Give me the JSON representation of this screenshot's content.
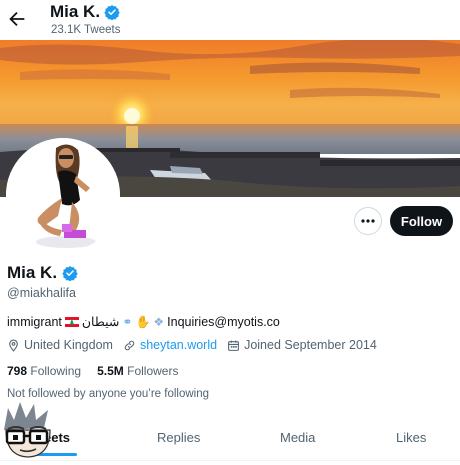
{
  "header": {
    "name": "Mia K.",
    "tweet_count": "23.1K Tweets"
  },
  "profile": {
    "name": "Mia K.",
    "handle": "@miakhalifa",
    "bio": {
      "prefix": "immigrant",
      "arabic": "شيطان",
      "inquiries": "Inquiries@myotis.co"
    },
    "location": "United Kingdom",
    "website": "sheytan.world",
    "joined": "Joined September 2014",
    "following_count": "798",
    "following_label": "Following",
    "followers_count": "5.5M",
    "followers_label": "Followers",
    "followed_by": "Not followed by anyone you’re following"
  },
  "actions": {
    "follow_label": "Follow"
  },
  "tabs": [
    {
      "label": "Tweets",
      "visible": "eets",
      "active": true
    },
    {
      "label": "Replies"
    },
    {
      "label": "Media"
    },
    {
      "label": "Likes"
    }
  ],
  "colors": {
    "accent": "#1d9bf0",
    "follow_bg": "#0f1419",
    "secondary_text": "#536471"
  }
}
